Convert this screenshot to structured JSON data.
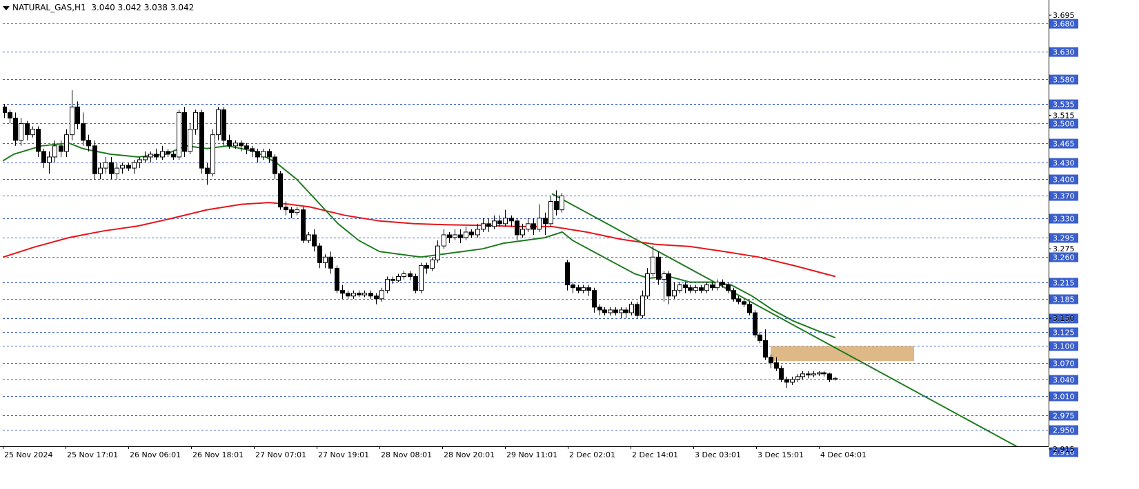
{
  "chart_header": {
    "symbol": "NATURAL_GAS,H1",
    "ohlc": "3.040 3.042 3.038 3.042"
  },
  "chart_data": {
    "type": "candlestick",
    "ylim": [
      2.895,
      3.7
    ],
    "price_axis_ticks": [
      "3.695",
      "3.515",
      "3.275",
      "3.150",
      "2.915"
    ],
    "level_lines": [
      "3.680",
      "3.630",
      "3.580",
      "3.535",
      "3.500",
      "3.465",
      "3.430",
      "3.400",
      "3.370",
      "3.330",
      "3.295",
      "3.260",
      "3.215",
      "3.185",
      "3.150",
      "3.125",
      "3.100",
      "3.070",
      "3.040",
      "3.010",
      "2.975",
      "2.950",
      "2.910"
    ],
    "time_labels": [
      "25 Nov 2024",
      "25 Nov 17:01",
      "26 Nov 06:01",
      "26 Nov 18:01",
      "27 Nov 07:01",
      "27 Nov 19:01",
      "28 Nov 08:01",
      "28 Nov 20:01",
      "29 Nov 11:01",
      "2 Dec 02:01",
      "2 Dec 14:01",
      "3 Dec 03:01",
      "3 Dec 15:01",
      "4 Dec 04:01"
    ],
    "candles": [
      [
        3.53,
        3.52,
        3.535,
        3.51
      ],
      [
        3.52,
        3.51,
        3.525,
        3.5
      ],
      [
        3.51,
        3.47,
        3.52,
        3.46
      ],
      [
        3.47,
        3.5,
        3.51,
        3.46
      ],
      [
        3.5,
        3.48,
        3.505,
        3.47
      ],
      [
        3.48,
        3.49,
        3.495,
        3.475
      ],
      [
        3.49,
        3.45,
        3.495,
        3.44
      ],
      [
        3.45,
        3.43,
        3.455,
        3.42
      ],
      [
        3.43,
        3.44,
        3.45,
        3.41
      ],
      [
        3.44,
        3.46,
        3.47,
        3.43
      ],
      [
        3.46,
        3.45,
        3.47,
        3.44
      ],
      [
        3.45,
        3.48,
        3.49,
        3.44
      ],
      [
        3.48,
        3.53,
        3.56,
        3.47
      ],
      [
        3.53,
        3.5,
        3.54,
        3.49
      ],
      [
        3.5,
        3.47,
        3.52,
        3.46
      ],
      [
        3.47,
        3.46,
        3.48,
        3.45
      ],
      [
        3.46,
        3.41,
        3.47,
        3.4
      ],
      [
        3.41,
        3.42,
        3.43,
        3.4
      ],
      [
        3.42,
        3.43,
        3.44,
        3.41
      ],
      [
        3.43,
        3.41,
        3.44,
        3.4
      ],
      [
        3.41,
        3.42,
        3.43,
        3.4
      ],
      [
        3.42,
        3.425,
        3.43,
        3.41
      ],
      [
        3.425,
        3.42,
        3.43,
        3.415
      ],
      [
        3.42,
        3.43,
        3.435,
        3.41
      ],
      [
        3.43,
        3.435,
        3.44,
        3.42
      ],
      [
        3.435,
        3.44,
        3.45,
        3.43
      ],
      [
        3.44,
        3.445,
        3.45,
        3.43
      ],
      [
        3.445,
        3.44,
        3.455,
        3.435
      ],
      [
        3.44,
        3.45,
        3.46,
        3.435
      ],
      [
        3.45,
        3.445,
        3.455,
        3.44
      ],
      [
        3.445,
        3.44,
        3.45,
        3.435
      ],
      [
        3.44,
        3.52,
        3.525,
        3.435
      ],
      [
        3.52,
        3.45,
        3.53,
        3.44
      ],
      [
        3.45,
        3.49,
        3.5,
        3.445
      ],
      [
        3.49,
        3.52,
        3.525,
        3.48
      ],
      [
        3.52,
        3.42,
        3.525,
        3.41
      ],
      [
        3.42,
        3.41,
        3.43,
        3.39
      ],
      [
        3.41,
        3.48,
        3.49,
        3.405
      ],
      [
        3.48,
        3.525,
        3.53,
        3.47
      ],
      [
        3.525,
        3.47,
        3.53,
        3.46
      ],
      [
        3.47,
        3.46,
        3.48,
        3.455
      ],
      [
        3.46,
        3.465,
        3.47,
        3.455
      ],
      [
        3.465,
        3.46,
        3.47,
        3.45
      ],
      [
        3.46,
        3.455,
        3.465,
        3.445
      ],
      [
        3.455,
        3.45,
        3.46,
        3.44
      ],
      [
        3.45,
        3.44,
        3.455,
        3.43
      ],
      [
        3.44,
        3.45,
        3.455,
        3.435
      ],
      [
        3.45,
        3.44,
        3.455,
        3.43
      ],
      [
        3.44,
        3.41,
        3.445,
        3.4
      ],
      [
        3.41,
        3.35,
        3.415,
        3.345
      ],
      [
        3.35,
        3.345,
        3.36,
        3.335
      ],
      [
        3.345,
        3.34,
        3.35,
        3.33
      ],
      [
        3.34,
        3.345,
        3.35,
        3.335
      ],
      [
        3.345,
        3.29,
        3.35,
        3.285
      ],
      [
        3.29,
        3.3,
        3.305,
        3.285
      ],
      [
        3.3,
        3.28,
        3.31,
        3.27
      ],
      [
        3.28,
        3.25,
        3.285,
        3.24
      ],
      [
        3.25,
        3.26,
        3.265,
        3.24
      ],
      [
        3.26,
        3.24,
        3.27,
        3.23
      ],
      [
        3.24,
        3.2,
        3.245,
        3.195
      ],
      [
        3.2,
        3.195,
        3.21,
        3.185
      ],
      [
        3.195,
        3.19,
        3.2,
        3.185
      ],
      [
        3.19,
        3.195,
        3.2,
        3.185
      ],
      [
        3.195,
        3.192,
        3.2,
        3.188
      ],
      [
        3.192,
        3.195,
        3.2,
        3.188
      ],
      [
        3.195,
        3.19,
        3.2,
        3.185
      ],
      [
        3.19,
        3.185,
        3.195,
        3.175
      ],
      [
        3.185,
        3.2,
        3.205,
        3.18
      ],
      [
        3.2,
        3.22,
        3.225,
        3.195
      ],
      [
        3.22,
        3.218,
        3.225,
        3.212
      ],
      [
        3.218,
        3.225,
        3.23,
        3.215
      ],
      [
        3.225,
        3.23,
        3.235,
        3.22
      ],
      [
        3.23,
        3.225,
        3.235,
        3.218
      ],
      [
        3.225,
        3.2,
        3.23,
        3.195
      ],
      [
        3.2,
        3.245,
        3.25,
        3.195
      ],
      [
        3.245,
        3.24,
        3.25,
        3.23
      ],
      [
        3.24,
        3.255,
        3.26,
        3.235
      ],
      [
        3.255,
        3.28,
        3.29,
        3.25
      ],
      [
        3.28,
        3.3,
        3.31,
        3.275
      ],
      [
        3.3,
        3.295,
        3.305,
        3.285
      ],
      [
        3.295,
        3.3,
        3.31,
        3.29
      ],
      [
        3.3,
        3.295,
        3.31,
        3.285
      ],
      [
        3.295,
        3.305,
        3.315,
        3.29
      ],
      [
        3.305,
        3.3,
        3.31,
        3.295
      ],
      [
        3.3,
        3.31,
        3.32,
        3.295
      ],
      [
        3.31,
        3.32,
        3.33,
        3.305
      ],
      [
        3.32,
        3.315,
        3.33,
        3.305
      ],
      [
        3.315,
        3.325,
        3.335,
        3.31
      ],
      [
        3.325,
        3.32,
        3.335,
        3.315
      ],
      [
        3.32,
        3.33,
        3.345,
        3.315
      ],
      [
        3.33,
        3.325,
        3.335,
        3.315
      ],
      [
        3.325,
        3.3,
        3.33,
        3.29
      ],
      [
        3.3,
        3.31,
        3.32,
        3.295
      ],
      [
        3.31,
        3.32,
        3.33,
        3.305
      ],
      [
        3.32,
        3.31,
        3.33,
        3.3
      ],
      [
        3.31,
        3.33,
        3.355,
        3.305
      ],
      [
        3.33,
        3.32,
        3.34,
        3.3
      ],
      [
        3.32,
        3.36,
        3.37,
        3.315
      ],
      [
        3.36,
        3.345,
        3.38,
        3.335
      ],
      [
        3.345,
        3.37,
        3.375,
        3.34
      ],
      [
        3.25,
        3.21,
        3.255,
        3.2
      ],
      [
        3.21,
        3.205,
        3.215,
        3.195
      ],
      [
        3.205,
        3.2,
        3.21,
        3.195
      ],
      [
        3.2,
        3.205,
        3.21,
        3.195
      ],
      [
        3.205,
        3.2,
        3.21,
        3.19
      ],
      [
        3.2,
        3.17,
        3.205,
        3.16
      ],
      [
        3.17,
        3.165,
        3.175,
        3.155
      ],
      [
        3.165,
        3.16,
        3.17,
        3.155
      ],
      [
        3.16,
        3.165,
        3.17,
        3.155
      ],
      [
        3.165,
        3.16,
        3.17,
        3.155
      ],
      [
        3.16,
        3.165,
        3.17,
        3.15
      ],
      [
        3.165,
        3.16,
        3.17,
        3.15
      ],
      [
        3.16,
        3.175,
        3.18,
        3.155
      ],
      [
        3.175,
        3.155,
        3.18,
        3.15
      ],
      [
        3.155,
        3.19,
        3.2,
        3.15
      ],
      [
        3.19,
        3.23,
        3.24,
        3.185
      ],
      [
        3.23,
        3.26,
        3.28,
        3.225
      ],
      [
        3.26,
        3.22,
        3.27,
        3.21
      ],
      [
        3.22,
        3.23,
        3.235,
        3.18
      ],
      [
        3.23,
        3.19,
        3.235,
        3.175
      ],
      [
        3.19,
        3.2,
        3.215,
        3.185
      ],
      [
        3.2,
        3.21,
        3.215,
        3.195
      ],
      [
        3.21,
        3.205,
        3.215,
        3.195
      ],
      [
        3.205,
        3.2,
        3.21,
        3.195
      ],
      [
        3.2,
        3.205,
        3.21,
        3.195
      ],
      [
        3.205,
        3.2,
        3.21,
        3.195
      ],
      [
        3.2,
        3.21,
        3.215,
        3.195
      ],
      [
        3.21,
        3.205,
        3.215,
        3.2
      ],
      [
        3.205,
        3.215,
        3.22,
        3.2
      ],
      [
        3.215,
        3.21,
        3.22,
        3.205
      ],
      [
        3.21,
        3.2,
        3.215,
        3.195
      ],
      [
        3.2,
        3.185,
        3.205,
        3.18
      ],
      [
        3.185,
        3.18,
        3.19,
        3.175
      ],
      [
        3.18,
        3.175,
        3.185,
        3.17
      ],
      [
        3.175,
        3.16,
        3.18,
        3.155
      ],
      [
        3.16,
        3.12,
        3.165,
        3.115
      ],
      [
        3.12,
        3.11,
        3.125,
        3.105
      ],
      [
        3.11,
        3.08,
        3.13,
        3.075
      ],
      [
        3.08,
        3.07,
        3.085,
        3.06
      ],
      [
        3.07,
        3.06,
        3.08,
        3.055
      ],
      [
        3.06,
        3.04,
        3.065,
        3.035
      ],
      [
        3.04,
        3.035,
        3.045,
        3.025
      ],
      [
        3.035,
        3.04,
        3.045,
        3.03
      ],
      [
        3.04,
        3.045,
        3.05,
        3.035
      ],
      [
        3.045,
        3.05,
        3.055,
        3.04
      ],
      [
        3.05,
        3.048,
        3.055,
        3.042
      ],
      [
        3.048,
        3.05,
        3.055,
        3.044
      ],
      [
        3.05,
        3.052,
        3.055,
        3.046
      ],
      [
        3.052,
        3.05,
        3.055,
        3.045
      ],
      [
        3.05,
        3.04,
        3.052,
        3.035
      ],
      [
        3.04,
        3.042,
        3.045,
        3.038
      ]
    ],
    "ma_fast": [
      [
        0,
        3.43
      ],
      [
        20,
        3.445
      ],
      [
        60,
        3.46
      ],
      [
        100,
        3.465
      ],
      [
        120,
        3.455
      ],
      [
        160,
        3.445
      ],
      [
        200,
        3.44
      ],
      [
        240,
        3.445
      ],
      [
        270,
        3.46
      ],
      [
        300,
        3.455
      ],
      [
        330,
        3.46
      ],
      [
        350,
        3.455
      ],
      [
        370,
        3.45
      ],
      [
        400,
        3.43
      ],
      [
        430,
        3.4
      ],
      [
        460,
        3.36
      ],
      [
        490,
        3.32
      ],
      [
        520,
        3.29
      ],
      [
        550,
        3.27
      ],
      [
        580,
        3.265
      ],
      [
        610,
        3.26
      ],
      [
        640,
        3.265
      ],
      [
        670,
        3.27
      ],
      [
        700,
        3.275
      ],
      [
        730,
        3.285
      ],
      [
        760,
        3.29
      ],
      [
        790,
        3.295
      ],
      [
        815,
        3.305
      ],
      [
        830,
        3.29
      ],
      [
        860,
        3.27
      ],
      [
        890,
        3.25
      ],
      [
        920,
        3.23
      ],
      [
        940,
        3.222
      ],
      [
        970,
        3.225
      ],
      [
        1000,
        3.215
      ],
      [
        1030,
        3.215
      ],
      [
        1060,
        3.21
      ],
      [
        1090,
        3.19
      ],
      [
        1120,
        3.165
      ],
      [
        1150,
        3.145
      ],
      [
        1180,
        3.13
      ],
      [
        1211,
        3.115
      ]
    ],
    "ma_slow": [
      [
        0,
        3.258
      ],
      [
        50,
        3.278
      ],
      [
        100,
        3.295
      ],
      [
        150,
        3.307
      ],
      [
        200,
        3.316
      ],
      [
        250,
        3.33
      ],
      [
        300,
        3.345
      ],
      [
        350,
        3.355
      ],
      [
        390,
        3.358
      ],
      [
        420,
        3.355
      ],
      [
        450,
        3.35
      ],
      [
        500,
        3.335
      ],
      [
        550,
        3.325
      ],
      [
        600,
        3.32
      ],
      [
        650,
        3.318
      ],
      [
        700,
        3.317
      ],
      [
        750,
        3.315
      ],
      [
        800,
        3.315
      ],
      [
        850,
        3.305
      ],
      [
        900,
        3.292
      ],
      [
        950,
        3.283
      ],
      [
        1000,
        3.279
      ],
      [
        1050,
        3.27
      ],
      [
        1100,
        3.26
      ],
      [
        1150,
        3.245
      ],
      [
        1211,
        3.225
      ]
    ],
    "trendline": {
      "start": [
        800,
        3.374
      ],
      "end": [
        1510,
        2.895
      ]
    },
    "zone": {
      "x1": 1117,
      "x2": 1325,
      "top": 3.1,
      "bottom": 3.073
    }
  }
}
